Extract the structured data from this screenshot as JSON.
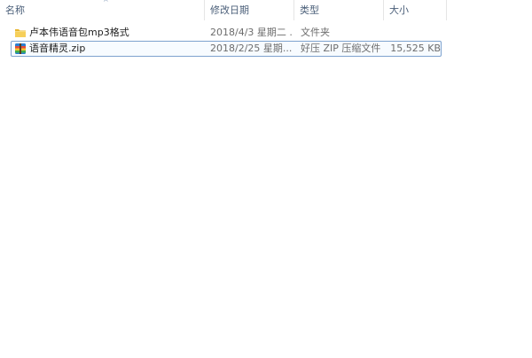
{
  "columns": {
    "name": "名称",
    "date": "修改日期",
    "type": "类型",
    "size": "大小"
  },
  "sort_indicator": "^",
  "files": [
    {
      "name": "卢本伟语音包mp3格式",
      "date": "2018/4/3 星期二 ...",
      "type": "文件夹",
      "size": "",
      "icon": "folder-icon",
      "selected": false
    },
    {
      "name": "语音精灵.zip",
      "date": "2018/2/25 星期...",
      "type": "好压 ZIP 压缩文件",
      "size": "15,525 KB",
      "icon": "zip-archive-icon",
      "selected": true
    }
  ],
  "colors": {
    "header_text": "#4c607a",
    "selection_border": "#7da2ce",
    "folder": "#f4c542",
    "secondary_text": "#6d6d6d"
  }
}
